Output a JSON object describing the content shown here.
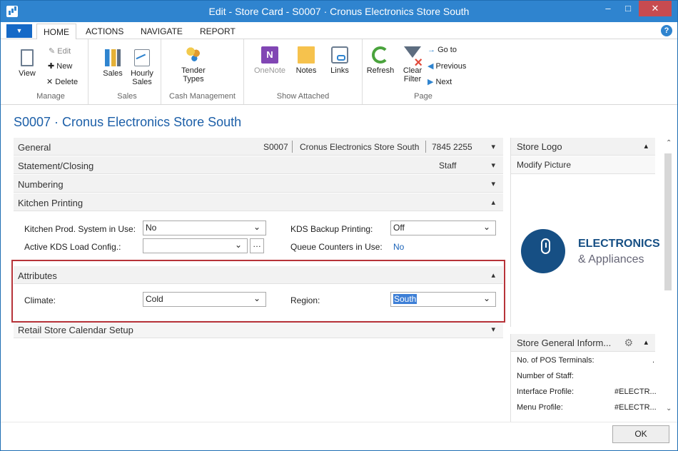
{
  "window": {
    "title": "Edit - Store Card - S0007 · Cronus Electronics Store South",
    "minimize": "–",
    "maximize": "□",
    "close": "✕"
  },
  "menubar": {
    "app_menu": "▼",
    "tabs": [
      "HOME",
      "ACTIONS",
      "NAVIGATE",
      "REPORT"
    ],
    "help": "?"
  },
  "ribbon": {
    "groups": [
      {
        "label": "Manage",
        "buttons": [
          "View",
          "Edit",
          "New",
          "Delete"
        ]
      },
      {
        "label": "Sales",
        "buttons": [
          "Sales",
          "Hourly Sales"
        ]
      },
      {
        "label": "Cash Management",
        "buttons": [
          "Tender Types"
        ]
      },
      {
        "label": "Show Attached",
        "buttons": [
          "OneNote",
          "Notes",
          "Links"
        ]
      },
      {
        "label": "Page",
        "buttons": [
          "Refresh",
          "Clear Filter",
          "Go to",
          "Previous",
          "Next"
        ]
      }
    ]
  },
  "page": {
    "title": "S0007 · Cronus Electronics Store South"
  },
  "fasttabs": {
    "general": {
      "label": "General",
      "summary": [
        "S0007",
        "Cronus Electronics Store South",
        "7845 2255"
      ],
      "state": "▾"
    },
    "statement": {
      "label": "Statement/Closing",
      "summary": "Staff",
      "state": "▾"
    },
    "numbering": {
      "label": "Numbering",
      "state": "▾"
    },
    "kitchen": {
      "label": "Kitchen Printing",
      "state": "▴"
    },
    "attributes": {
      "label": "Attributes",
      "state": "▴"
    },
    "retail": {
      "label": "Retail Store Calendar Setup",
      "state": "▾"
    }
  },
  "kitchen_fields": {
    "kitchen_prod_label": "Kitchen Prod. System in Use:",
    "kitchen_prod_value": "No",
    "active_kds_label": "Active KDS Load Config.:",
    "active_kds_value": "",
    "kds_backup_label": "KDS Backup Printing:",
    "kds_backup_value": "Off",
    "queue_label": "Queue Counters in Use:",
    "queue_value": "No"
  },
  "attributes": {
    "climate_label": "Climate:",
    "climate_value": "Cold",
    "region_label": "Region:",
    "region_value": "South"
  },
  "factbox": {
    "store_logo": {
      "title": "Store Logo",
      "action": "Modify Picture",
      "brand_title": "ELECTRONICS",
      "brand_subtitle": "& Appliances",
      "state": "▴"
    },
    "store_info": {
      "title": "Store General Inform...",
      "state": "▴",
      "rows": [
        {
          "label": "No. of POS Terminals:",
          "value": "."
        },
        {
          "label": "Number of Staff:",
          "value": ""
        },
        {
          "label": "Interface Profile:",
          "value": "#ELECTR..."
        },
        {
          "label": "Menu Profile:",
          "value": "#ELECTR..."
        }
      ]
    }
  },
  "footer": {
    "ok": "OK"
  },
  "colors": {
    "title_bar": "#2f84cf",
    "accent": "#1c5fa8",
    "highlight_border": "#b73339",
    "selection": "#3d7fd6"
  }
}
